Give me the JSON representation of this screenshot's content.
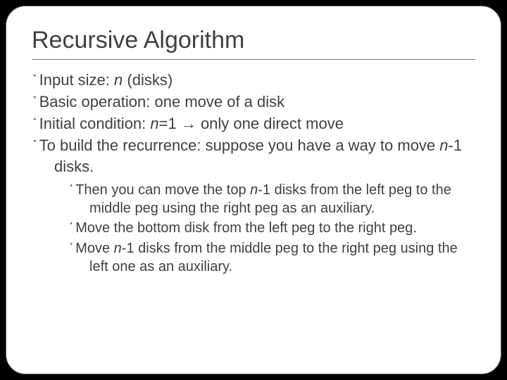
{
  "title": "Recursive Algorithm",
  "bullet_glyph": "་",
  "bullets": [
    {
      "pre": "Input size: ",
      "em": "n",
      "post": " (disks)"
    },
    {
      "pre": "Basic operation: one move of a disk",
      "em": "",
      "post": ""
    },
    {
      "pre": "Initial condition: ",
      "em": "n",
      "post": "=1 → only one direct move"
    },
    {
      "pre": "To build the recurrence: suppose you have a way to move ",
      "em": "n",
      "post": "-1 disks."
    }
  ],
  "sub_bullets": [
    {
      "pre": "Then you can move the top ",
      "em": "n",
      "post": "-1 disks from the left peg to the middle peg using the right peg as an auxiliary."
    },
    {
      "pre": "Move the bottom disk from the left peg to the right peg.",
      "em": "",
      "post": ""
    },
    {
      "pre": "Move ",
      "em": "n",
      "post": "-1 disks from the middle peg to the right peg using the left one as an auxiliary."
    }
  ]
}
